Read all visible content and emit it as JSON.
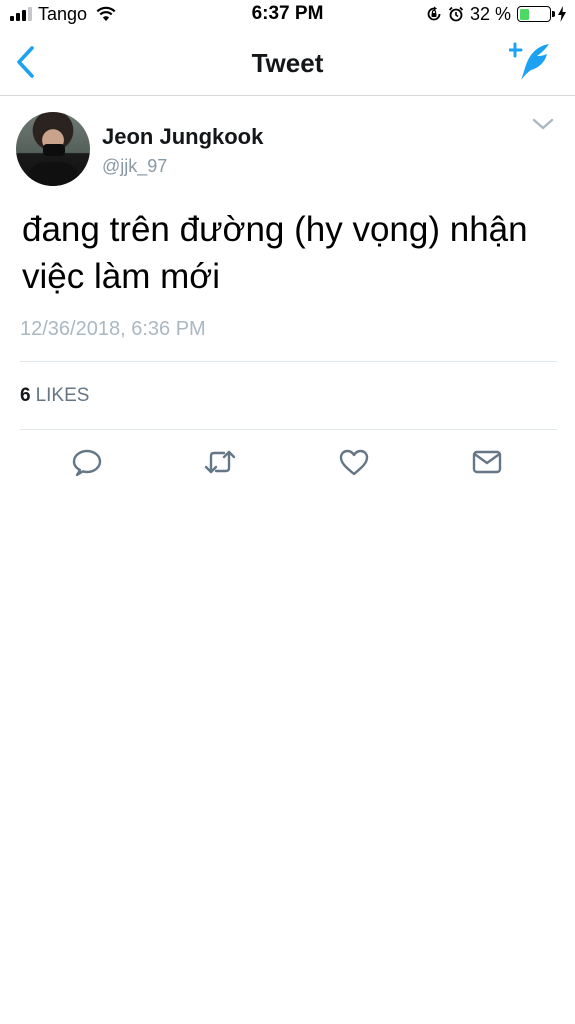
{
  "status_bar": {
    "carrier": "Tango",
    "time": "6:37 PM",
    "battery_percent": "32 %",
    "battery_level": 0.32,
    "icons": [
      "signal-icon",
      "wifi-icon",
      "orientation-lock-icon",
      "alarm-icon",
      "battery-icon",
      "charging-bolt-icon"
    ]
  },
  "nav": {
    "title": "Tweet",
    "back_icon": "chevron-left-icon",
    "compose_icon": "compose-feather-icon"
  },
  "tweet": {
    "author_name": "Jeon Jungkook",
    "author_handle": "@jjk_97",
    "text": "đang trên đường (hy vọng) nhận việc làm mới",
    "timestamp": "12/36/2018, 6:36 PM",
    "likes_count": "6",
    "likes_label": "LIKES"
  },
  "actions": [
    {
      "name": "reply",
      "icon": "reply-icon"
    },
    {
      "name": "retweet",
      "icon": "retweet-icon"
    },
    {
      "name": "like",
      "icon": "heart-icon"
    },
    {
      "name": "message",
      "icon": "envelope-icon"
    }
  ],
  "colors": {
    "accent": "#1da1f2",
    "secondary_text": "#8899a6",
    "battery_green": "#4cd964"
  }
}
